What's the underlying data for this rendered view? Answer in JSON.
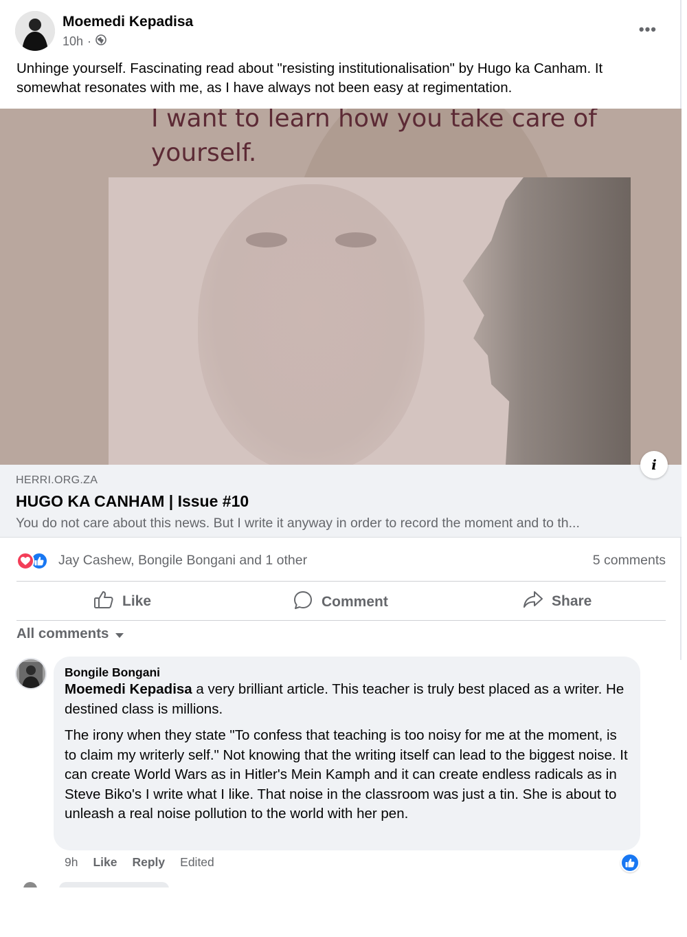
{
  "post": {
    "author": "Moemedi Kepadisa",
    "time": "10h",
    "separator": "·",
    "privacy_icon": "globe-icon",
    "more_label": "•••",
    "text": "Unhinge yourself. Fascinating read about \"resisting institutionalisation\" by Hugo ka Canham. It somewhat resonates with me, as I have always not been easy at regimentation."
  },
  "media": {
    "quote_line1": "I want to learn how you take care of",
    "quote_line2": "yourself.",
    "info_label": "i"
  },
  "link": {
    "domain": "HERRI.ORG.ZA",
    "title": "HUGO KA CANHAM | Issue #10",
    "description": "You do not care about this news. But I write it anyway in order to record the moment and to th..."
  },
  "reactions": {
    "icons": [
      "love-icon",
      "like-icon"
    ],
    "names": "Jay Cashew, Bongile Bongani and 1 other",
    "comments": "5 comments"
  },
  "actions": {
    "like": "Like",
    "comment": "Comment",
    "share": "Share"
  },
  "comments_filter": "All comments",
  "comment": {
    "author": "Bongile Bongani",
    "mention": "Moemedi Kepadisa",
    "text_after_mention": " a very brilliant article. This teacher is truly best placed as a writer. He destined class is millions.",
    "paragraph2": "The irony when they state \"To confess that teaching is too noisy for me at the moment, is to claim my writerly self.\" Not knowing that the writing itself can lead to the biggest noise. It can create World Wars as in Hitler's Mein Kamph and it can create endless radicals as in Steve Biko's I write what I like. That noise in the classroom was just a tin. She is about to unleash a real noise pollution to the world with her pen.",
    "time": "9h",
    "like": "Like",
    "reply": "Reply",
    "edited": "Edited"
  },
  "colors": {
    "brand_blue": "#1877f2",
    "love_red": "#f33e58",
    "secondary_text": "#65676b"
  }
}
